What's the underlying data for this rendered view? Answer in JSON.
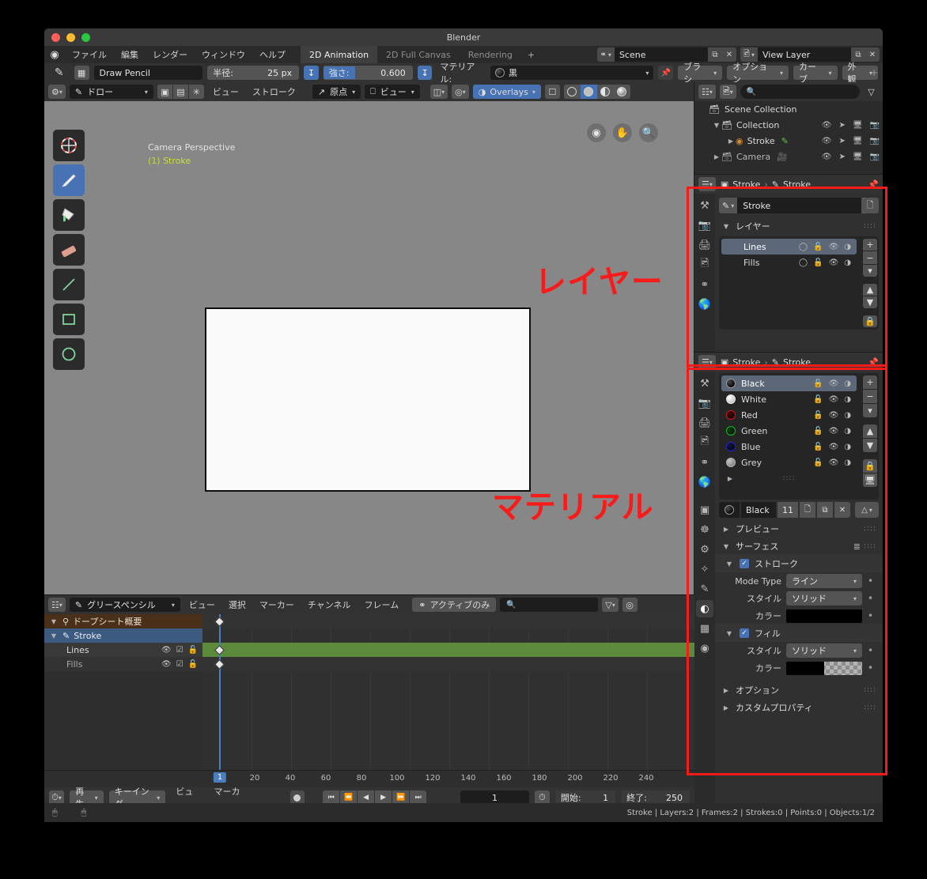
{
  "window": {
    "title": "Blender"
  },
  "topbar": {
    "menus": [
      "ファイル",
      "編集",
      "レンダー",
      "ウィンドウ",
      "ヘルプ"
    ],
    "workspaces": [
      {
        "label": "2D Animation",
        "active": true
      },
      {
        "label": "2D Full Canvas",
        "active": false
      },
      {
        "label": "Rendering",
        "active": false
      }
    ],
    "add_workspace": "+",
    "scene_name": "Scene",
    "view_layer_name": "View Layer"
  },
  "tool_settings": {
    "brush_name": "Draw Pencil",
    "radius_label": "半径:",
    "radius_value": "25 px",
    "strength_label": "強さ:",
    "strength_value": "0.600",
    "material_label": "マテリアル:",
    "material_value": "黒",
    "menus": [
      "ブラシ",
      "オプション",
      "カーブ",
      "外観"
    ]
  },
  "viewport": {
    "mode": "ドロー",
    "menus": [
      "ビュー",
      "ストローク"
    ],
    "pivot": "原点",
    "orientation": "ビュー",
    "overlays_label": "Overlays",
    "camera_label": "Camera Perspective",
    "object_label": "(1) Stroke",
    "tools": [
      "cursor-tool",
      "draw-tool",
      "fill-tool",
      "erase-tool",
      "line-tool",
      "box-tool",
      "circle-tool"
    ]
  },
  "outliner": {
    "search_placeholder": "",
    "rows": [
      {
        "label": "Scene Collection",
        "indent": 0,
        "icon": "collection-icon",
        "expander": ""
      },
      {
        "label": "Collection",
        "indent": 1,
        "icon": "collection-icon",
        "expander": "▼"
      },
      {
        "label": "Stroke",
        "indent": 2,
        "icon": "gpencil-icon",
        "expander": "▶"
      },
      {
        "label": "Camera",
        "indent": 1,
        "icon": "collection-icon",
        "expander": "▶"
      }
    ]
  },
  "layers_editor": {
    "breadcrumb_object": "Stroke",
    "breadcrumb_data": "Stroke",
    "datablock_name": "Stroke",
    "panel_title": "レイヤー",
    "layers": [
      {
        "name": "Lines",
        "selected": true
      },
      {
        "name": "Fills",
        "selected": false
      }
    ]
  },
  "material_editor": {
    "breadcrumb_object": "Stroke",
    "breadcrumb_data": "Stroke",
    "slots": [
      {
        "name": "Black",
        "color": "#101010",
        "selected": true
      },
      {
        "name": "White",
        "color": "#f2f2f2",
        "selected": false
      },
      {
        "name": "Red",
        "color": "#e01010",
        "selected": false
      },
      {
        "name": "Green",
        "color": "#10c020",
        "selected": false
      },
      {
        "name": "Blue",
        "color": "#2020e0",
        "selected": false
      },
      {
        "name": "Grey",
        "color": "#9a9a9a",
        "selected": false
      }
    ],
    "active_material": "Black",
    "users_count": "11",
    "panels": {
      "preview": "プレビュー",
      "surface": "サーフェス",
      "stroke": "ストローク",
      "fill": "フィル",
      "options": "オプション",
      "custom_properties": "カスタムプロパティ"
    },
    "stroke_rows": [
      {
        "label": "Mode Type",
        "value": "ライン",
        "type": "dropdown"
      },
      {
        "label": "スタイル",
        "value": "ソリッド",
        "type": "dropdown"
      },
      {
        "label": "カラー",
        "value": "#000000",
        "type": "color"
      }
    ],
    "fill_rows": [
      {
        "label": "スタイル",
        "value": "ソリッド",
        "type": "dropdown"
      },
      {
        "label": "カラー",
        "value": "#000000",
        "type": "color-alpha"
      }
    ]
  },
  "dopesheet": {
    "editor_mode": "グリースペンシル",
    "menus": [
      "ビュー",
      "選択",
      "マーカー",
      "チャンネル",
      "フレーム"
    ],
    "filter_label": "アクティブのみ",
    "search_placeholder": "",
    "channels": [
      {
        "label": "ドープシート概要",
        "type": "summary"
      },
      {
        "label": "Stroke",
        "type": "object"
      },
      {
        "label": "Lines",
        "type": "layer",
        "active": true
      },
      {
        "label": "Fills",
        "type": "layer",
        "active": false
      }
    ],
    "ruler_ticks": [
      "20",
      "40",
      "60",
      "80",
      "100",
      "120",
      "140",
      "160",
      "180",
      "200",
      "220",
      "240"
    ],
    "current_frame_badge": "1"
  },
  "timeline_footer": {
    "playback_menu": "再生",
    "keying_menu": "キーイング",
    "menus": [
      "ビュー",
      "マーカー"
    ],
    "current_frame": "1",
    "start_label": "開始:",
    "start_value": "1",
    "end_label": "終了:",
    "end_value": "250"
  },
  "statusbar": {
    "stats": "Stroke | Layers:2 | Frames:2 | Strokes:0 | Points:0 | Objects:1/2"
  },
  "annotations": [
    {
      "text": "レイヤー",
      "id": "layer-annotation"
    },
    {
      "text": "マテリアル",
      "id": "material-annotation"
    }
  ],
  "colors": {
    "accent_blue": "#4772b3",
    "annotation_red": "#f91a1a",
    "highlight_green": "#5b8a3a"
  }
}
